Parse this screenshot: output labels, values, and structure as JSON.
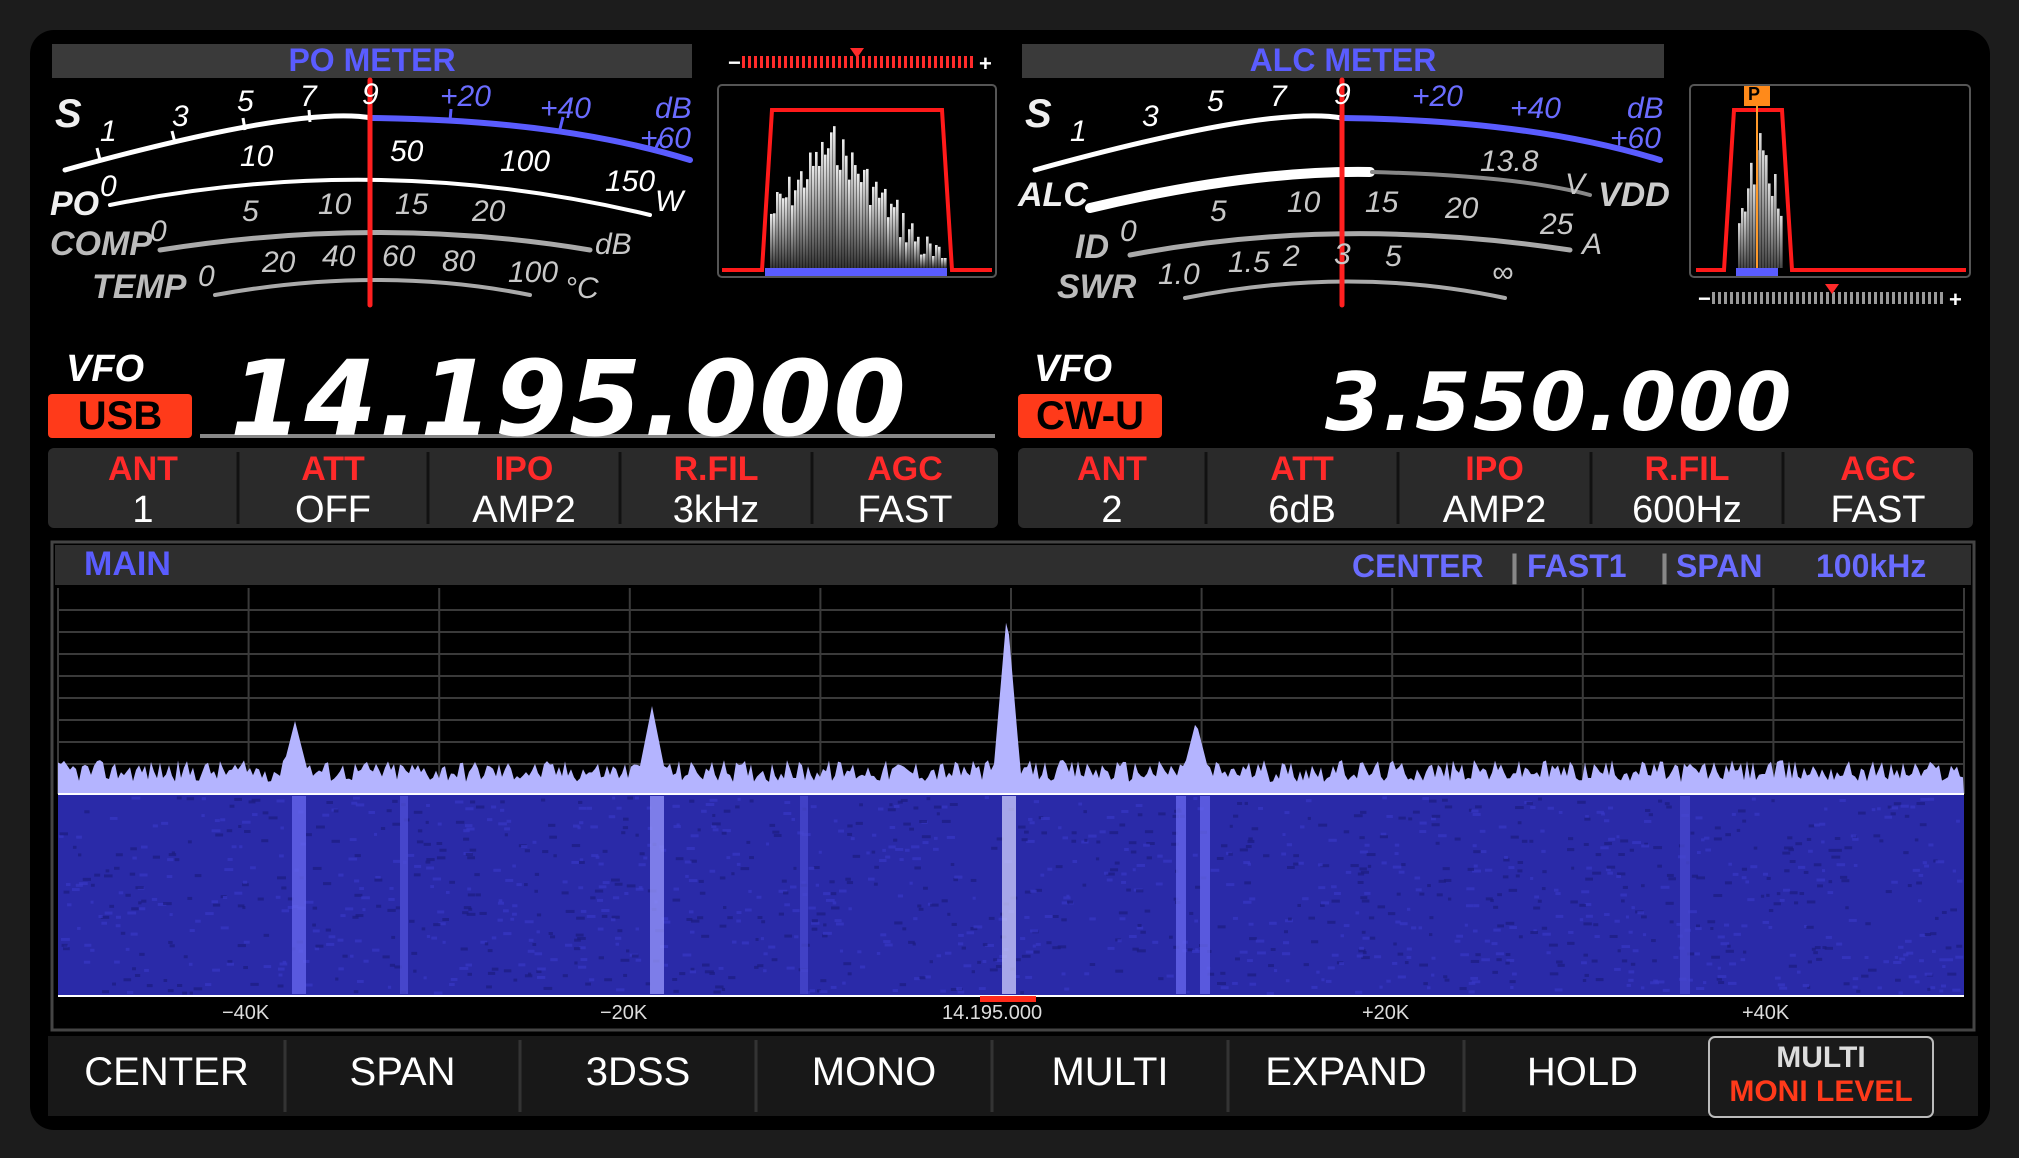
{
  "left_meter": {
    "title": "PO METER",
    "s_row": {
      "s": "S",
      "ticks": [
        "1",
        "3",
        "5",
        "7",
        "9",
        "+20",
        "+40",
        "+60"
      ],
      "unit": "dB"
    },
    "po_row": {
      "label": "PO",
      "ticks": [
        "0",
        "10",
        "50",
        "100",
        "150"
      ],
      "unit": "W"
    },
    "comp_row": {
      "label": "COMP",
      "ticks": [
        "0",
        "5",
        "10",
        "15",
        "20"
      ],
      "unit": "dB"
    },
    "temp_row": {
      "label": "TEMP",
      "ticks": [
        "0",
        "20",
        "40",
        "60",
        "80",
        "100"
      ],
      "unit": "°C"
    }
  },
  "right_meter": {
    "title": "ALC METER",
    "s_row": {
      "s": "S",
      "ticks": [
        "1",
        "3",
        "5",
        "7",
        "9",
        "+20",
        "+40",
        "+60"
      ],
      "unit": "dB"
    },
    "alc_row": {
      "label": "ALC",
      "vdd_value": "13.8",
      "vdd_unit": "V",
      "vdd_label": "VDD"
    },
    "id_row": {
      "label": "ID",
      "ticks": [
        "0",
        "5",
        "10",
        "15",
        "20",
        "25"
      ],
      "unit": "A"
    },
    "swr_row": {
      "label": "SWR",
      "ticks": [
        "1.0",
        "1.5",
        "2",
        "3",
        "5",
        "∞"
      ]
    }
  },
  "filter_scope_right": {
    "marker": "P"
  },
  "vfo_a": {
    "label": "VFO",
    "mode": "USB",
    "frequency": "14.195.000"
  },
  "vfo_b": {
    "label": "VFO",
    "mode": "CW-U",
    "frequency": "3.550.000"
  },
  "settings_a": [
    {
      "label": "ANT",
      "value": "1"
    },
    {
      "label": "ATT",
      "value": "OFF"
    },
    {
      "label": "IPO",
      "value": "AMP2"
    },
    {
      "label": "R.FIL",
      "value": "3kHz"
    },
    {
      "label": "AGC",
      "value": "FAST"
    }
  ],
  "settings_b": [
    {
      "label": "ANT",
      "value": "2"
    },
    {
      "label": "ATT",
      "value": "6dB"
    },
    {
      "label": "IPO",
      "value": "AMP2"
    },
    {
      "label": "R.FIL",
      "value": "600Hz"
    },
    {
      "label": "AGC",
      "value": "FAST"
    }
  ],
  "scope": {
    "title": "MAIN",
    "mode": "CENTER",
    "speed": "FAST1",
    "span_label": "SPAN",
    "span_value": "100kHz",
    "axis": [
      "−40K",
      "−20K",
      "14.195.000",
      "+20K",
      "+40K"
    ]
  },
  "function_keys": [
    "CENTER",
    "SPAN",
    "3DSS",
    "MONO",
    "MULTI",
    "EXPAND",
    "HOLD"
  ],
  "multi_key": {
    "top": "MULTI",
    "bottom": "MONI LEVEL"
  },
  "colors": {
    "accent_blue": "#5a5cff",
    "label_red": "#ff2a2a",
    "mode_badge": "#ff3a1a",
    "waterfall": "#2a2aa8",
    "spectrum": "#b4b4ff"
  }
}
